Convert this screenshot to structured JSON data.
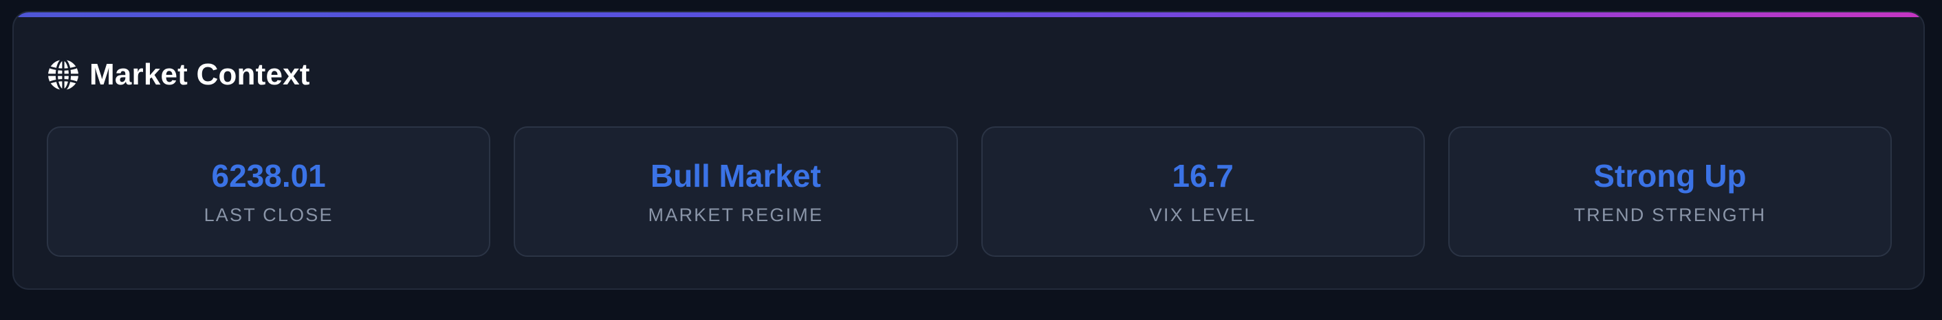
{
  "header": {
    "icon": "globe-icon",
    "title": "Market Context"
  },
  "colors": {
    "background": "#0c111c",
    "panel": "#151b28",
    "card": "#1a2130",
    "value": "#3b73e6",
    "label": "#8a95a8",
    "accent_start": "#4f56d6",
    "accent_end": "#c436c2"
  },
  "metrics": [
    {
      "value": "6238.01",
      "label": "LAST CLOSE"
    },
    {
      "value": "Bull Market",
      "label": "MARKET REGIME"
    },
    {
      "value": "16.7",
      "label": "VIX LEVEL"
    },
    {
      "value": "Strong Up",
      "label": "TREND STRENGTH"
    }
  ]
}
